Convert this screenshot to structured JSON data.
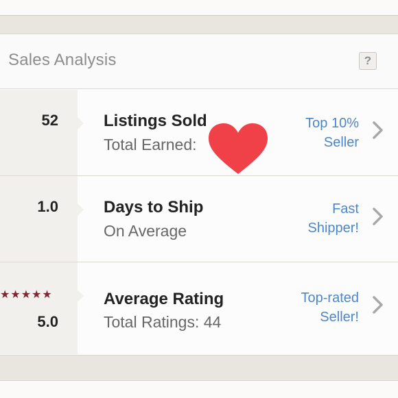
{
  "header": {
    "title": "Sales Analysis",
    "help_label": "?"
  },
  "rows": [
    {
      "stat": "52",
      "title": "Listings Sold",
      "subtitle": "Total Earned:",
      "badge_line1": "Top 10%",
      "badge_line2": "Seller"
    },
    {
      "stat": "1.0",
      "title": "Days to Ship",
      "subtitle": "On Average",
      "badge_line1": "Fast",
      "badge_line2": "Shipper!"
    },
    {
      "stat": "5.0",
      "stars": "★★★★★",
      "star_rating": 5,
      "title": "Average Rating",
      "subtitle": "Total Ratings: 44",
      "badge_line1": "Top-rated",
      "badge_line2": "Seller!"
    }
  ],
  "icons": {
    "help": "question-mark-icon",
    "chevron": "chevron-right-icon",
    "heart": "heart-icon"
  },
  "colors": {
    "background": "#e9e6e0",
    "card": "#fbfafa",
    "stat_panel": "#f2f0ec",
    "title_gray": "#8c8c8c",
    "link_blue": "#4a86c9",
    "star_maroon": "#7d2731",
    "heart_red": "#f04048",
    "chevron_gray": "#a8a8a8"
  }
}
